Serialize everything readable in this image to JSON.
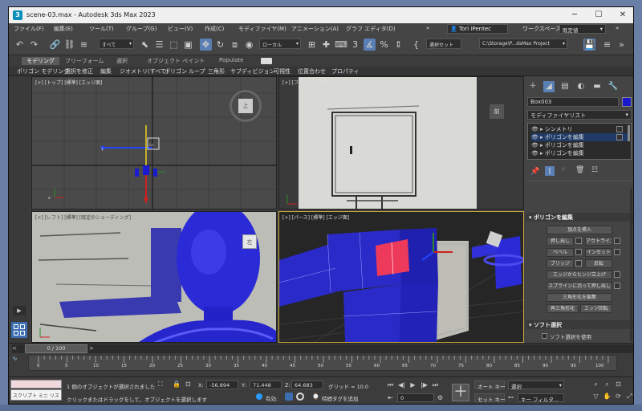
{
  "window": {
    "title": "scene-03.max - Autodesk 3ds Max 2023",
    "controls": [
      "─",
      "☐",
      "✕"
    ]
  },
  "menubar": {
    "items": [
      "ファイル(F)",
      "編集(E)",
      "ツール(T)",
      "グループ(G)",
      "ビュー(V)",
      "作成(C)",
      "モディファイヤ(M)",
      "アニメーション(A)",
      "グラフ エディタ(D)"
    ],
    "overflow": "»",
    "user": "Tori iPentec",
    "workspace_label": "ワークスペース:",
    "workspace_value": "既定値"
  },
  "toolbar": {
    "selection_filter": "すべて",
    "coord_system": "ローカル",
    "named_selection": "選択セット",
    "project_path": "C:\\Storage\\P...dsMax Project"
  },
  "ribbon": {
    "tabs": [
      "モデリング",
      "フリーフォーム",
      "選択",
      "オブジェクト ペイント",
      "Populate"
    ],
    "active_tab": "モデリング",
    "subtools": [
      "ポリゴン モデリング",
      "選択を修正",
      "編集",
      "ジオメトリ(すべて)",
      "ポリゴン",
      "ループ",
      "三角形",
      "サブディビジョン",
      "可視性",
      "位置合わせ",
      "プロパティ"
    ]
  },
  "viewports": {
    "top": "[+] [トップ] [標準] [エッジ面]",
    "front": "[+] [フロント] [標準] [既定のシェーディング]",
    "left": "[+] [レフト] [標準] [既定のシェーディング]",
    "perspective": "[+] [パース] [標準] [エッジ面]",
    "viewcube_top": "上",
    "viewcube_front": "前",
    "viewcube_left": "左"
  },
  "modify_panel": {
    "object_name": "Box003",
    "modifier_list": "モディファイヤリスト",
    "stack": [
      "シンメトリ",
      "ポリゴンを編集",
      "ポリゴンを編集",
      "ポリゴンを編集"
    ],
    "edit_poly_rollout": "ポリゴンを編集",
    "insert_vertex": "頂点を挿入",
    "extrude": "押し出し",
    "outline": "アウトライン",
    "bevel": "ベベル",
    "inset": "インセット",
    "bridge": "ブリッジ",
    "flip": "反転",
    "hinge": "エッジからヒンジ立上げ",
    "extrude_spline": "スプラインに沿って押し出し",
    "edit_tri": "三角形化を編集",
    "retriangulate": "再三角形化",
    "turn_edge": "エッジ回転",
    "soft_sel_rollout": "ソフト選択",
    "use_soft_sel": "ソフト選択を使用"
  },
  "timeline": {
    "frame": "0 / 100",
    "ticks": [
      "0",
      "5",
      "10",
      "15",
      "20",
      "25",
      "30",
      "35",
      "40",
      "45",
      "50",
      "55",
      "60",
      "65",
      "70",
      "75",
      "80",
      "85",
      "90",
      "95",
      "100"
    ]
  },
  "status": {
    "script_label": "スクリプト ミニ リス",
    "selection_info": "1 個のオブジェクトが選択されました",
    "prompt": "クリックまたはドラッグをして、オブジェクトを選択します",
    "x_label": "X:",
    "x_value": "-56.894",
    "y_label": "Y:",
    "y_value": "71.448",
    "z_label": "Z:",
    "z_value": "64.683",
    "grid": "グリッド = 10.0",
    "enable_label": "有効:",
    "add_tag": "時間タグを追加",
    "autokey": "オート キー",
    "setkey": "セット キー",
    "key_select": "選択",
    "key_filter": "キー フィルタ...",
    "current_frame": "0"
  }
}
